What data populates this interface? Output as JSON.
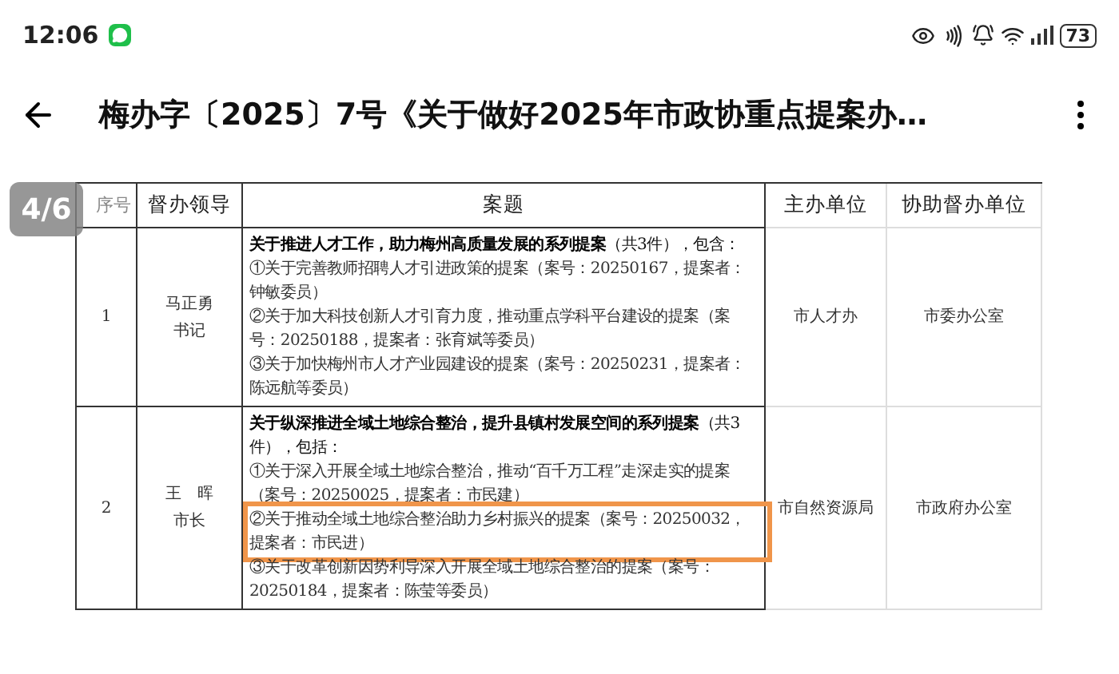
{
  "status_bar": {
    "time": "12:06",
    "battery": "73"
  },
  "app_bar": {
    "title": "梅办字〔2025〕7号《关于做好2025年市政协重点提案办…"
  },
  "page_indicator": "4/6",
  "table": {
    "columns": [
      "序号",
      "督办领导",
      "案题",
      "主办单位",
      "协助督办单位"
    ],
    "rows": [
      {
        "number": "1",
        "leader": [
          "马正勇",
          "书记"
        ],
        "heading": "**关于推进人才工作，助力梅州高质量发展的系列提案**（共3件），包含：",
        "items": [
          {
            "text": "①关于完善教师招聘人才引进政策的提案（案号：20250167，提案者：钟敏委员）",
            "highlighted": false
          },
          {
            "text": "②关于加大科技创新人才引育力度，推动重点学科平台建设的提案（案号：20250188，提案者：张育斌等委员）",
            "highlighted": false
          },
          {
            "text": "③关于加快梅州市人才产业园建设的提案（案号：20250231，提案者：陈远航等委员）",
            "highlighted": false
          }
        ],
        "lead_unit": "市人才办",
        "assisting_unit": "市委办公室"
      },
      {
        "number": "2",
        "leader": [
          "王　晖",
          "市长"
        ],
        "heading": "**关于纵深推进全域土地综合整治，提升县镇村发展空间的系列提案**（共3件），包括：",
        "items": [
          {
            "text": "①关于深入开展全域土地综合整治，推动“百千万工程”走深走实的提案（案号：20250025，提案者：市民建）",
            "highlighted": false
          },
          {
            "text": "②关于推动全域土地综合整治助力乡村振兴的提案（案号：20250032，提案者：市民进）",
            "highlighted": true
          },
          {
            "text": "③关于改革创新因势利导深入开展全域土地综合整治的提案（案号：20250184，提案者：陈莹等委员）",
            "highlighted": false
          }
        ],
        "lead_unit": "市自然资源局",
        "assisting_unit": "市政府办公室"
      }
    ]
  }
}
